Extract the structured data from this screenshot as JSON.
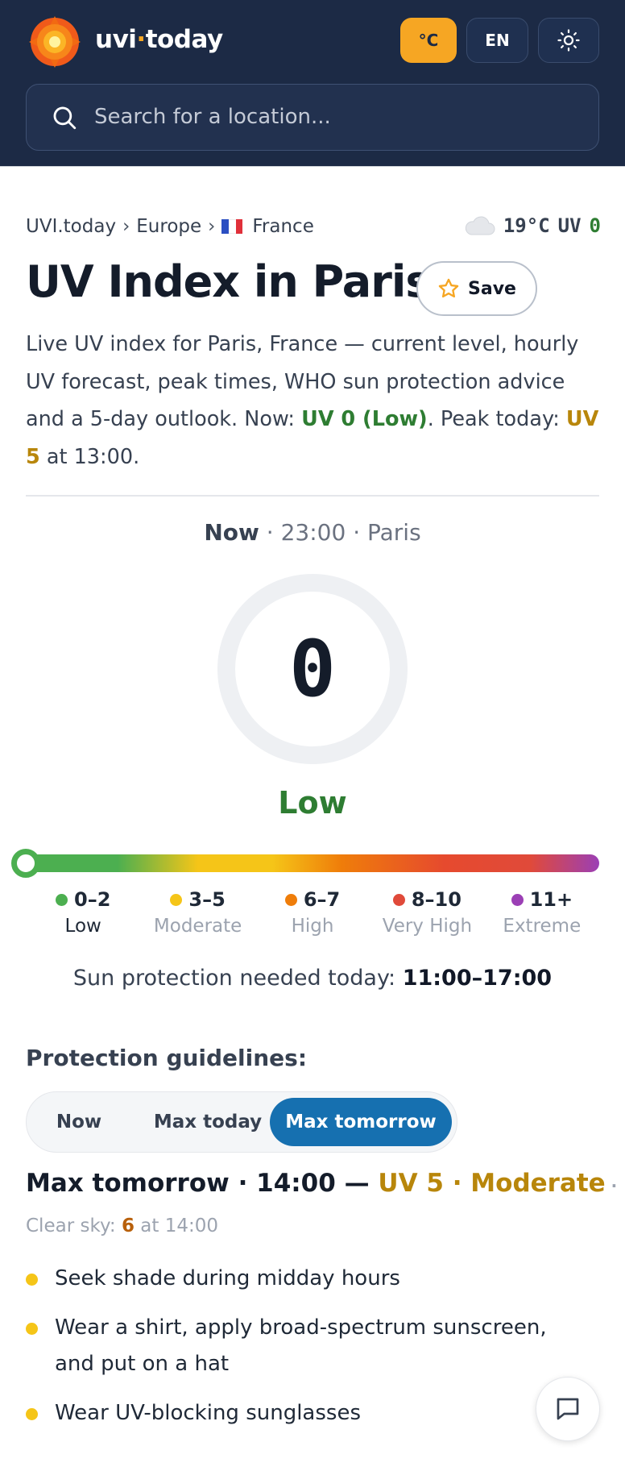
{
  "header": {
    "brand_main": "uvi",
    "brand_dot": "·",
    "brand_tld": "today",
    "unit_label": "°C",
    "lang_label": "EN",
    "theme_icon": "sun-icon"
  },
  "search": {
    "placeholder": "Search for a location...",
    "icon": "search-icon"
  },
  "breadcrumb": {
    "items": [
      "UVI.today",
      "Europe",
      "France"
    ],
    "separator": "›",
    "flag": "france-flag-icon"
  },
  "current_weather": {
    "icon": "cloud-icon",
    "temp": "19°C",
    "uv_label": "UV",
    "uv_value": "0"
  },
  "page": {
    "title": "UV Index in Paris",
    "save_label": "Save",
    "description_pre": "Live UV index for Paris, France — current level, hourly UV forecast, peak times, WHO sun protection advice and a 5-day outlook. Now: ",
    "description_now": "UV 0 (Low)",
    "description_mid": ". Peak today: ",
    "description_peak": "UV 5",
    "description_post": " at 13:00."
  },
  "now": {
    "label": "Now",
    "time": "23:00",
    "city": "Paris",
    "sep": "·",
    "uv_value": "0",
    "level": "Low"
  },
  "scale": {
    "current_uv": 0,
    "categories": [
      {
        "range": "0–2",
        "label": "Low",
        "color": "#4caf50"
      },
      {
        "range": "3–5",
        "label": "Moderate",
        "color": "#f5c518"
      },
      {
        "range": "6–7",
        "label": "High",
        "color": "#ef7d0a"
      },
      {
        "range": "8–10",
        "label": "Very High",
        "color": "#e04a3a"
      },
      {
        "range": "11+",
        "label": "Extreme",
        "color": "#9b3fb5"
      }
    ]
  },
  "protection": {
    "label": "Sun protection needed today:",
    "window": "11:00–17:00"
  },
  "guidelines": {
    "title": "Protection guidelines:",
    "tabs": [
      "Now",
      "Max today",
      "Max tomorrow"
    ],
    "active_tab": "Max tomorrow",
    "heading_prefix": "Max tomorrow · 14:00 — ",
    "heading_uv": "UV 5 · Moderate",
    "heading_tail": " ·",
    "clear_sky_label": "Clear sky:",
    "clear_sky_value": "6",
    "clear_sky_time": "at 14:00",
    "tips": [
      "Seek shade during midday hours",
      "Wear a shirt, apply broad-spectrum sunscreen, and put on a hat",
      "Wear UV-blocking sunglasses"
    ]
  },
  "colors": {
    "header_bg": "#1c2a45",
    "accent": "#f6a623",
    "low_green": "#2e7d32",
    "moderate_gold": "#b8860b",
    "tab_active": "#1670b0"
  },
  "chat": {
    "icon": "chat-bubble-icon"
  }
}
